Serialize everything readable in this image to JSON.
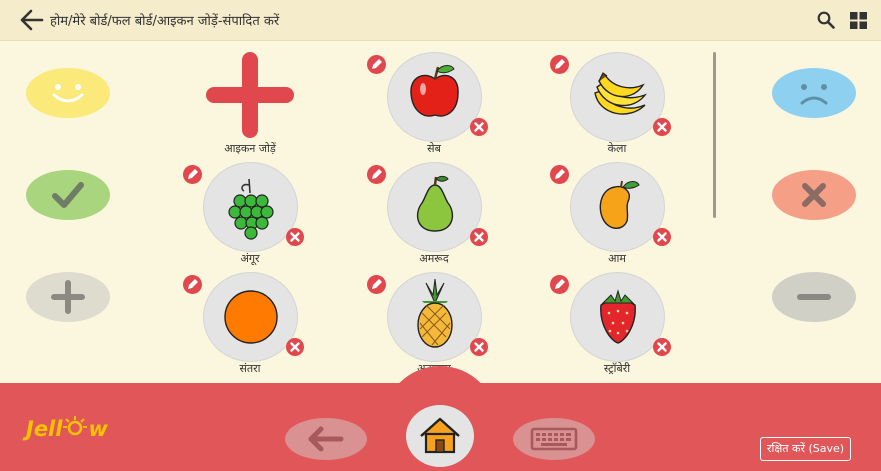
{
  "header": {
    "breadcrumb": "होम/मेरे बोर्ड/फल बोर्ड/आइकन जोड़ें-संपादित करें",
    "back_icon": "back-arrow-icon",
    "search_icon": "search-icon",
    "grid_icon": "grid-icon"
  },
  "left_buttons": [
    {
      "name": "like",
      "icon": "smiley-icon",
      "color": "#fbe97a"
    },
    {
      "name": "yes",
      "icon": "check-icon",
      "color": "#a8d57e"
    },
    {
      "name": "more",
      "icon": "plus-icon",
      "color": "#dedbcf"
    }
  ],
  "right_buttons": [
    {
      "name": "dislike",
      "icon": "sad-face-icon",
      "color": "#8ed0ef"
    },
    {
      "name": "no",
      "icon": "cross-icon",
      "color": "#f59f87"
    },
    {
      "name": "less",
      "icon": "minus-icon",
      "color": "#d1d0c7"
    }
  ],
  "add_tile": {
    "label": "आइकन जोड़ें",
    "icon": "add-icon",
    "color": "#e0484d"
  },
  "tiles": [
    {
      "id": "apple",
      "label": "सेब",
      "icon": "apple-icon"
    },
    {
      "id": "banana",
      "label": "केला",
      "icon": "banana-icon"
    },
    {
      "id": "grapes",
      "label": "अंगूर",
      "icon": "grapes-icon"
    },
    {
      "id": "guava",
      "label": "अमरूद",
      "icon": "guava-icon"
    },
    {
      "id": "mango",
      "label": "आम",
      "icon": "mango-icon"
    },
    {
      "id": "orange",
      "label": "संतरा",
      "icon": "orange-icon"
    },
    {
      "id": "pineapple",
      "label": "अनानास",
      "icon": "pineapple-icon"
    },
    {
      "id": "strawberry",
      "label": "स्ट्रॉबेरी",
      "icon": "strawberry-icon"
    }
  ],
  "footer": {
    "logo_text_left": "Jell",
    "logo_text_right": "w",
    "save_label": "रक्षित करें (Save)",
    "back_icon": "back-arrow-icon",
    "home_icon": "home-icon",
    "keyboard_icon": "keyboard-icon"
  },
  "colors": {
    "accent": "#e15659",
    "background": "#fbf6de",
    "header": "#f5eccb"
  }
}
